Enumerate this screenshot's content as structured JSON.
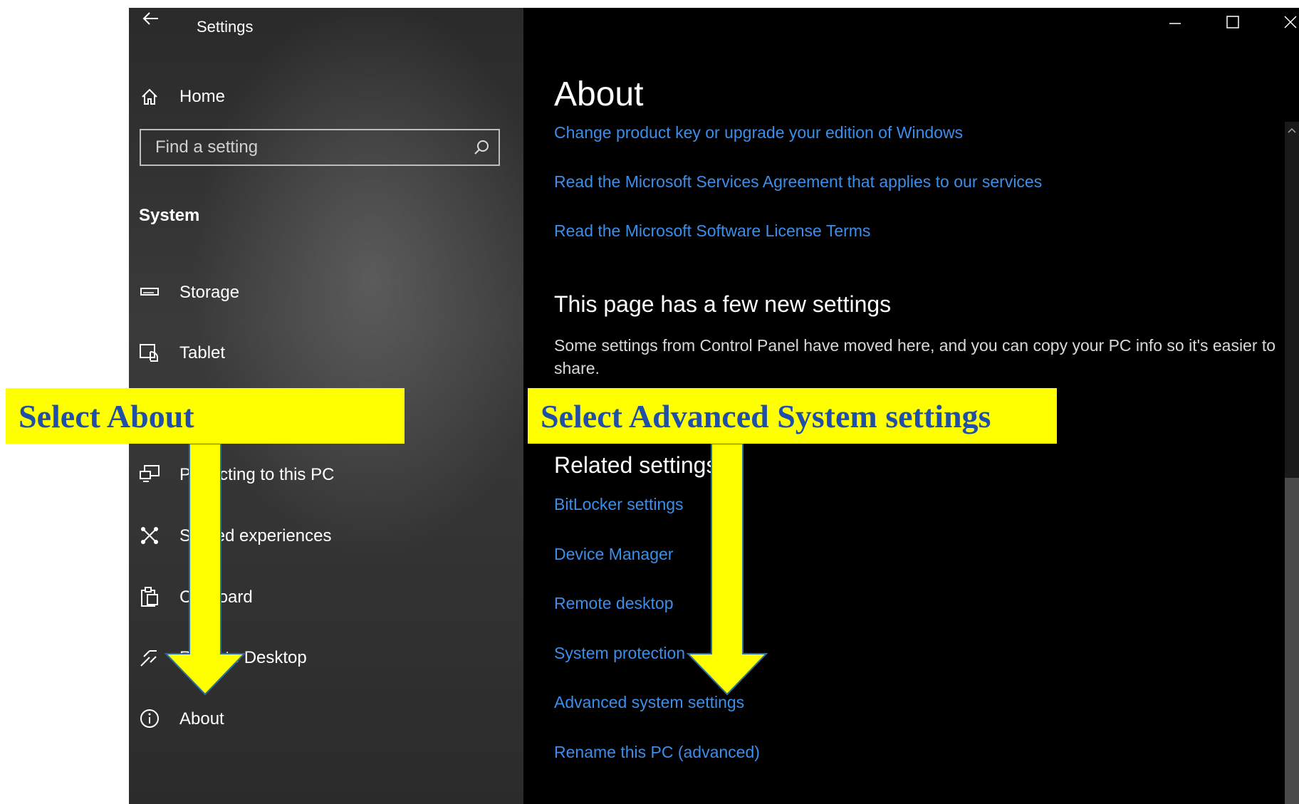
{
  "window": {
    "title": "Settings"
  },
  "sidebar": {
    "home_label": "Home",
    "search_placeholder": "Find a setting",
    "section_label": "System",
    "items": [
      {
        "label": "Storage",
        "icon": "storage-icon"
      },
      {
        "label": "Tablet",
        "icon": "tablet-icon"
      },
      {
        "label": "Projecting to this PC",
        "icon": "projecting-icon"
      },
      {
        "label": "Shared experiences",
        "icon": "shared-experiences-icon"
      },
      {
        "label": "Clipboard",
        "icon": "clipboard-icon"
      },
      {
        "label": "Remote Desktop",
        "icon": "remote-desktop-icon"
      },
      {
        "label": "About",
        "icon": "info-icon"
      }
    ]
  },
  "content": {
    "title": "About",
    "links": [
      "Change product key or upgrade your edition of Windows",
      "Read the Microsoft Services Agreement that applies to our services",
      "Read the Microsoft Software License Terms"
    ],
    "new_settings_heading": "This page has a few new settings",
    "new_settings_text": "Some settings from Control Panel have moved here, and you can copy your PC info so it's easier to share.",
    "related_heading": "Related settings",
    "related_links": [
      "BitLocker settings",
      "Device Manager",
      "Remote desktop",
      "System protection",
      "Advanced system settings",
      "Rename this PC (advanced)"
    ]
  },
  "annotations": {
    "left_callout": "Select About",
    "right_callout": "Select Advanced System settings",
    "callout_bg": "#ffff00",
    "callout_text_color": "#1f4fa8"
  },
  "colors": {
    "link": "#3b8eea",
    "background": "#000000"
  }
}
